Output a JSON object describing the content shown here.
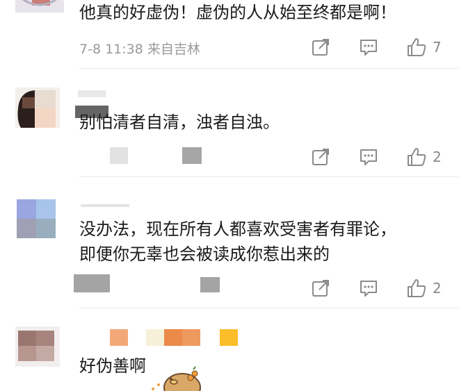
{
  "comments": [
    {
      "text_lines": [
        "他真的好虚伪！虚伪的人从始至终都是啊！"
      ],
      "meta": "7-8 11:38 来自吉林",
      "likes": "7"
    },
    {
      "text_lines": [
        "别怕清者自清，浊者自浊。"
      ],
      "meta": "",
      "likes": "2"
    },
    {
      "text_lines": [
        "没办法，现在所有人都喜欢受害者有罪论，",
        "即便你无辜也会被读成你惹出来的"
      ],
      "meta": "",
      "likes": "2"
    },
    {
      "text_lines": [
        "好伪善啊"
      ],
      "meta": "",
      "likes": ""
    }
  ],
  "icons": {
    "share": "share-icon",
    "comment": "comment-icon",
    "like": "thumbs-up-icon",
    "sticker": "capybara-sticker-icon"
  },
  "colors": {
    "text": "#1a1a1a",
    "meta": "#9a9a9a",
    "icon": "#8a8a8a",
    "divider": "#ececec"
  }
}
